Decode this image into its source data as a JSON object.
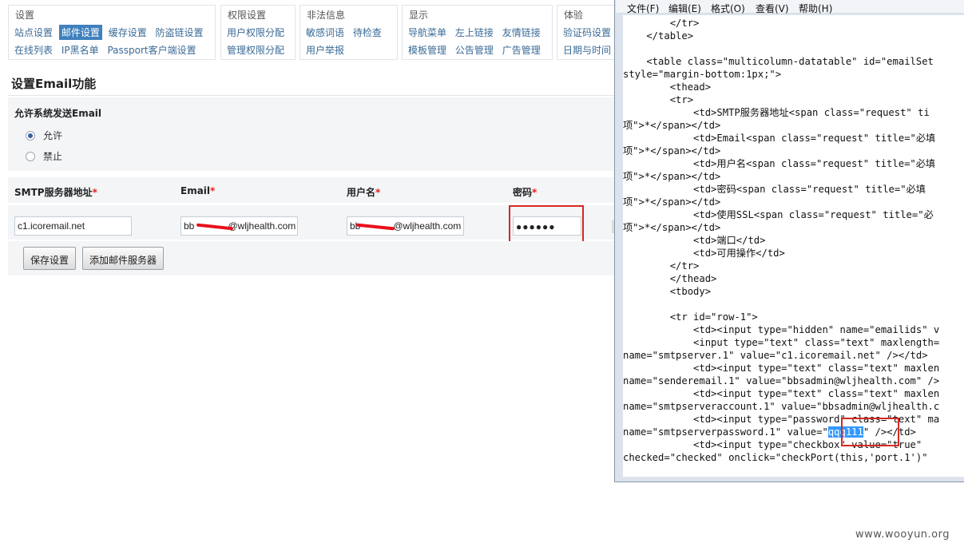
{
  "nav": {
    "groups": [
      {
        "title": "设置",
        "row1": [
          "站点设置",
          "邮件设置",
          "缓存设置",
          "防盗链设置"
        ],
        "row2": [
          "在线列表",
          "IP黑名单",
          "Passport客户端设置"
        ],
        "active": "邮件设置"
      },
      {
        "title": "权限设置",
        "row1": [
          "用户权限分配"
        ],
        "row2": [
          "管理权限分配"
        ]
      },
      {
        "title": "非法信息",
        "row1": [
          "敏感词语",
          "待检查"
        ],
        "row2": [
          "用户举报"
        ]
      },
      {
        "title": "显示",
        "row1": [
          "导航菜单",
          "左上链接",
          "友情链接"
        ],
        "row2": [
          "模板管理",
          "公告管理",
          "广告管理"
        ]
      },
      {
        "title": "体验",
        "row1": [
          "验证码设置"
        ],
        "row2": [
          "日期与时间"
        ]
      }
    ]
  },
  "page": {
    "title": "设置Email功能",
    "allow_label": "允许系统发送Email",
    "options": {
      "allow": "允许",
      "deny": "禁止",
      "selected": "allow"
    },
    "columns": {
      "smtp": "SMTP服务器地址",
      "email": "Email",
      "username": "用户名",
      "password": "密码",
      "required_mark": "*"
    },
    "row": {
      "smtp": "c1.icoremail.net",
      "email_visible": "bb",
      "email_rest": "@wljhealth.com",
      "user_visible": "bb",
      "user_rest": "@wljhealth.com",
      "password_mask": "●●●●●●"
    },
    "buttons": {
      "save": "保存设置",
      "add": "添加邮件服务器"
    }
  },
  "notepad": {
    "menu": [
      "文件(F)",
      "编辑(E)",
      "格式(O)",
      "查看(V)",
      "帮助(H)"
    ],
    "selected_text": "qqq111",
    "lines": [
      "        </tr>",
      "    </table>",
      "",
      "    <table class=\"multicolumn-datatable\" id=\"emailSet",
      "style=\"margin-bottom:1px;\">",
      "        <thead>",
      "        <tr>",
      "            <td>SMTP服务器地址<span class=\"request\" ti",
      "项\">*</span></td>",
      "            <td>Email<span class=\"request\" title=\"必填",
      "项\">*</span></td>",
      "            <td>用户名<span class=\"request\" title=\"必填",
      "项\">*</span></td>",
      "            <td>密码<span class=\"request\" title=\"必填",
      "项\">*</span></td>",
      "            <td>使用SSL<span class=\"request\" title=\"必",
      "项\">*</span></td>",
      "            <td>端口</td>",
      "            <td>可用操作</td>",
      "        </tr>",
      "        </thead>",
      "        <tbody>",
      "",
      "        <tr id=\"row-1\">",
      "            <td><input type=\"hidden\" name=\"emailids\" v",
      "            <input type=\"text\" class=\"text\" maxlength=",
      "name=\"smtpserver.1\" value=\"c1.icoremail.net\" /></td>",
      "            <td><input type=\"text\" class=\"text\" maxlen",
      "name=\"senderemail.1\" value=\"bbsadmin@wljhealth.com\" />",
      "            <td><input type=\"text\" class=\"text\" maxlen",
      "name=\"smtpserveraccount.1\" value=\"bbsadmin@wljhealth.c",
      "            <td><input type=\"password\" class=\"text\" ma",
      "name=\"smtpserverpassword.1\" value=\"",
      "            <td><input type=\"checkbox\" value=\"true\"",
      "checked=\"checked\" onclick=\"checkPort(this,'port.1')\""
    ],
    "pw_line_suffix": "\" /></td>"
  },
  "watermark": "www.wooyun.org",
  "colors": {
    "accent": "#3f80bd",
    "highlight_box": "#d42a22",
    "redaction": "#e8101a",
    "selection": "#3399ff"
  }
}
